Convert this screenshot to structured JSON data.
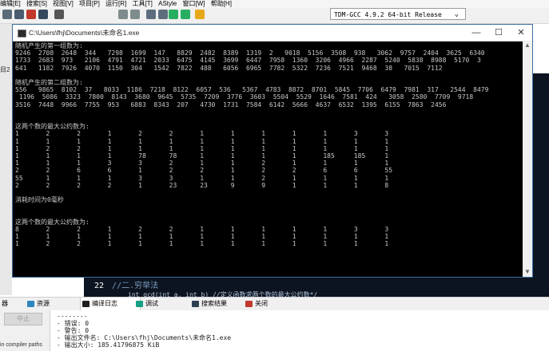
{
  "menu": [
    "编辑[E]",
    "搜索[S]",
    "视图[V]",
    "项目[P]",
    "运行[R]",
    "工具[T]",
    "AStyle",
    "窗口[W]",
    "帮助[H]"
  ],
  "compiler": {
    "selected": "TDM-GCC 4.9.2 64-bit Release"
  },
  "side": {
    "label": "目2"
  },
  "console": {
    "title": "C:\\Users\\fhj\\Documents\\未命名1.exe",
    "lines": [
      "随机产生的第一组数为:",
      "9246  2708  2648  344   7298  1699  147   8829  2482  8389  1319  2   9018  5156  3508  938   3062  9757  2404  3625  6340",
      "1733  2683  973   2106  4791  4721  2033  6475  4145  3699  6447  7958  1360  3206  4966  2287  5240  5838  8988  5170  3",
      "641   1182  7926  4070  1150  304   1542  7822  488   6056  6965  7782  5322  7236  7521  9468  38   7015  7112",
      "",
      "随机产生的第二组数为:",
      "556   9865  8102  37   8033  1186  7218  8122  6057  536   5367  4783  8872  8701  5845  7706  6479  7981  317   2544  8479",
      " 1196  5086  3323  7800  8143  3680  9645  5735  7209  3776  3603  5504  5529  1646  7581  424   3058  2580  7709  9718",
      "3516  7448  9966  7755  953   6883  8343  207   4730  1731  7584  6142  5666  4637  6532  1395  6155  7863  2456",
      "",
      "",
      "这两个数的最大公约数为:",
      "1       2       2       1       2       2       1       1       1       1       1       3       3",
      "1       1       1       1       1       1       1       1       1       1       1       1       1",
      "1       2       2       1       1       1       1       1       1       1       1       1       1",
      "1       1       1       1       78      78      1       1       1       1       185     185     1",
      "1       1       1       3       3       2       1       1       2       1       1       1       1",
      "2       2       6       6       1       2       2       1       2       2       6       6       55",
      "55      1       1       1       3       3       1       1       2       1       1       1       1",
      "2       2       2       2       1       23      23      9       9       1       1       1       8",
      "",
      "消耗时间为0毫秒",
      "",
      "",
      "这两个数的最大公约数为:",
      "8       2       2       1       2       2       1       1       1       1       1       3       3",
      "1       1       1       1       1       1       1       1       1       1       1       1       1",
      "1       2       2       1       1       1       1       1       1       1       1       1       1"
    ]
  },
  "editor": {
    "line_number": "22",
    "comment": "//二.穷举法",
    "next_line": "int gcd(int a, int b) //定义函数求两个数的最大公约数*/"
  },
  "bottom_tabs": [
    "器",
    "资源",
    "编译日志",
    "调试",
    "搜索结果",
    "关闭"
  ],
  "stop_button": "中止",
  "checkbox_label": "in compiler paths",
  "log_lines": [
    "--------",
    "- 错误: 0",
    "- 警告: 0",
    "- 输出文件名: C:\\Users\\fhj\\Documents\\未命名1.exe",
    "- 输出大小: 185.41796875 KiB"
  ]
}
